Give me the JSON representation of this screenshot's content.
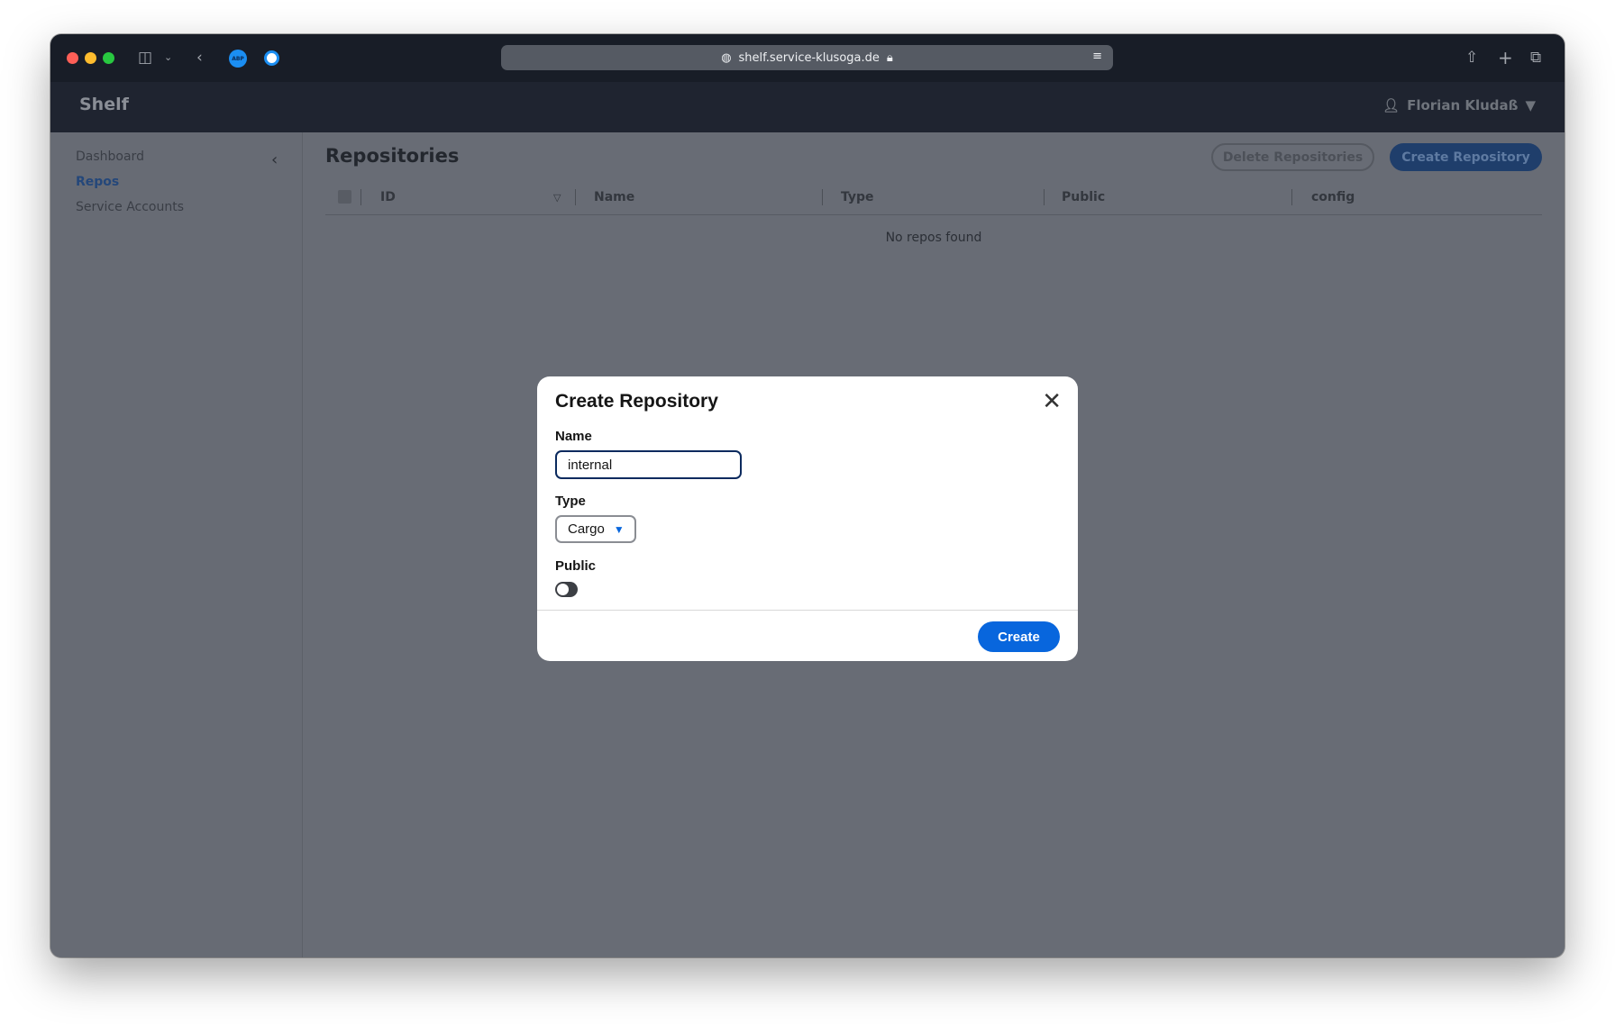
{
  "browser": {
    "url": "shelf.service-klusoga.de",
    "extensions": [
      "ABP",
      "1Password"
    ]
  },
  "header": {
    "brand": "Shelf",
    "user": "Florian Kludaß"
  },
  "sidebar": {
    "items": [
      {
        "label": "Dashboard"
      },
      {
        "label": "Repos",
        "active": true
      },
      {
        "label": "Service Accounts"
      }
    ]
  },
  "main": {
    "title": "Repositories",
    "delete_label": "Delete Repositories",
    "create_label": "Create Repository",
    "columns": [
      "ID",
      "Name",
      "Type",
      "Public",
      "config"
    ],
    "empty": "No repos found"
  },
  "modal": {
    "title": "Create Repository",
    "name_label": "Name",
    "name_value": "internal",
    "type_label": "Type",
    "type_value": "Cargo",
    "public_label": "Public",
    "public_on": false,
    "submit": "Create"
  },
  "colors": {
    "primary": "#0866dd",
    "overlay_bg": "#686c75"
  }
}
